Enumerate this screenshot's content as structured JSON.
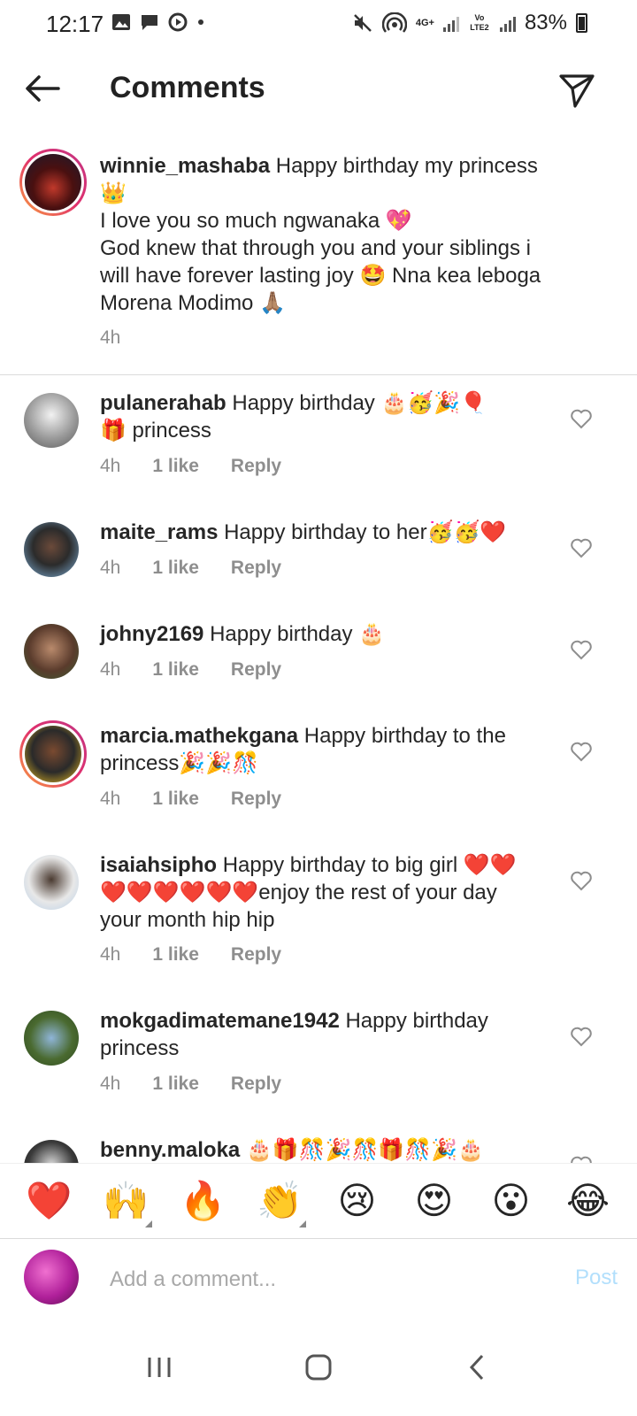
{
  "status_bar": {
    "time": "12:17",
    "network": "4G+",
    "volte": "Vo LTE2",
    "battery": "83%"
  },
  "header": {
    "title": "Comments"
  },
  "caption": {
    "username": "winnie_mashaba",
    "text_line1": "Happy birthday my princess",
    "text_line2": "👑",
    "text_line3": "I love you so much ngwanaka 💖",
    "text_line4": "God knew that through you and your siblings i",
    "text_line5": "will have forever lasting joy 🤩 Nna kea leboga",
    "text_line6": "Morena Modimo 🙏🏽",
    "time": "4h"
  },
  "comments": [
    {
      "username": "pulanerahab",
      "text": "Happy birthday 🎂🥳🎉🎈",
      "text2": "🎁 princess",
      "time": "4h",
      "likes": "1 like",
      "reply": "Reply"
    },
    {
      "username": "maite_rams",
      "text": "Happy birthday to her🥳🥳❤️",
      "time": "4h",
      "likes": "1 like",
      "reply": "Reply"
    },
    {
      "username": "johny2169",
      "text": "Happy birthday 🎂",
      "time": "4h",
      "likes": "1 like",
      "reply": "Reply"
    },
    {
      "username": "marcia.mathekgana",
      "text": "Happy birthday to the",
      "text2": "princess🎉🎉🎊",
      "time": "4h",
      "likes": "1 like",
      "reply": "Reply"
    },
    {
      "username": "isaiahsipho",
      "text": "Happy birthday to big girl ❤️❤️",
      "text2": "❤️❤️❤️❤️❤️❤️enjoy the rest of your day",
      "text3": "your month hip hip",
      "time": "4h",
      "likes": "1 like",
      "reply": "Reply"
    },
    {
      "username": "mokgadimatemane1942",
      "text": "Happy birthday",
      "text2": "princess",
      "time": "4h",
      "likes": "1 like",
      "reply": "Reply"
    },
    {
      "username": "benny.maloka",
      "text": "🎂🎁🎊🎉🎊🎁🎊🎉🎂"
    }
  ],
  "emoji_bar": [
    "❤️",
    "🙌",
    "🔥",
    "👏",
    "😢",
    "😍",
    "😮",
    "😂"
  ],
  "add_comment": {
    "placeholder": "Add a comment...",
    "post_label": "Post"
  },
  "colors": {
    "post_disabled": "#b2dffc",
    "meta_gray": "#8e8e8e"
  }
}
